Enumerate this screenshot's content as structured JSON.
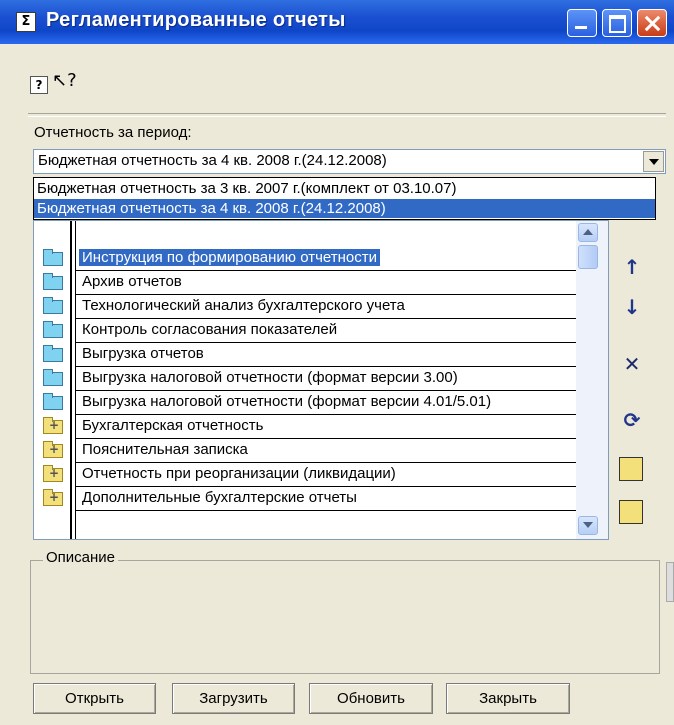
{
  "window": {
    "title": "Регламентированные отчеты"
  },
  "toolbar": {
    "help_icon": "help-icon",
    "whats_this_icon": "whats-this-icon"
  },
  "period": {
    "label": "Отчетность за период:",
    "selected": "Бюджетная отчетность за 4 кв. 2008 г.(24.12.2008)",
    "options": [
      "Бюджетная отчетность за 3 кв. 2007 г.(комплект от 03.10.07)",
      "Бюджетная отчетность за 4 кв. 2008 г.(24.12.2008)"
    ]
  },
  "tree": {
    "items": [
      {
        "label": "Инструкция по формированию отчетности",
        "icon": "folder-icon"
      },
      {
        "label": "Архив отчетов",
        "icon": "folder-icon"
      },
      {
        "label": "Технологический анализ бухгалтерского учета",
        "icon": "folder-icon"
      },
      {
        "label": "Контроль согласования показателей",
        "icon": "folder-icon"
      },
      {
        "label": "Выгрузка отчетов",
        "icon": "folder-icon"
      },
      {
        "label": "Выгрузка налоговой отчетности (формат версии 3.00)",
        "icon": "folder-icon"
      },
      {
        "label": "Выгрузка налоговой отчетности (формат версии 4.01/5.01)",
        "icon": "folder-icon"
      },
      {
        "label": "Бухгалтерская отчетность",
        "icon": "folder-group-icon"
      },
      {
        "label": "Пояснительная записка",
        "icon": "folder-group-icon"
      },
      {
        "label": "Отчетность при реорганизации (ликвидации)",
        "icon": "folder-group-icon"
      },
      {
        "label": "Дополнительные бухгалтерские отчеты",
        "icon": "folder-group-icon"
      }
    ]
  },
  "side_buttons": {
    "up": "↑",
    "down": "↓",
    "delete": "✕",
    "refresh": "⟳"
  },
  "description": {
    "label": "Описание"
  },
  "buttons": {
    "open": "Открыть",
    "load": "Загрузить",
    "refresh": "Обновить",
    "close": "Закрыть"
  },
  "colors": {
    "title_bar": "#0f46c8",
    "selection": "#316ac5"
  }
}
